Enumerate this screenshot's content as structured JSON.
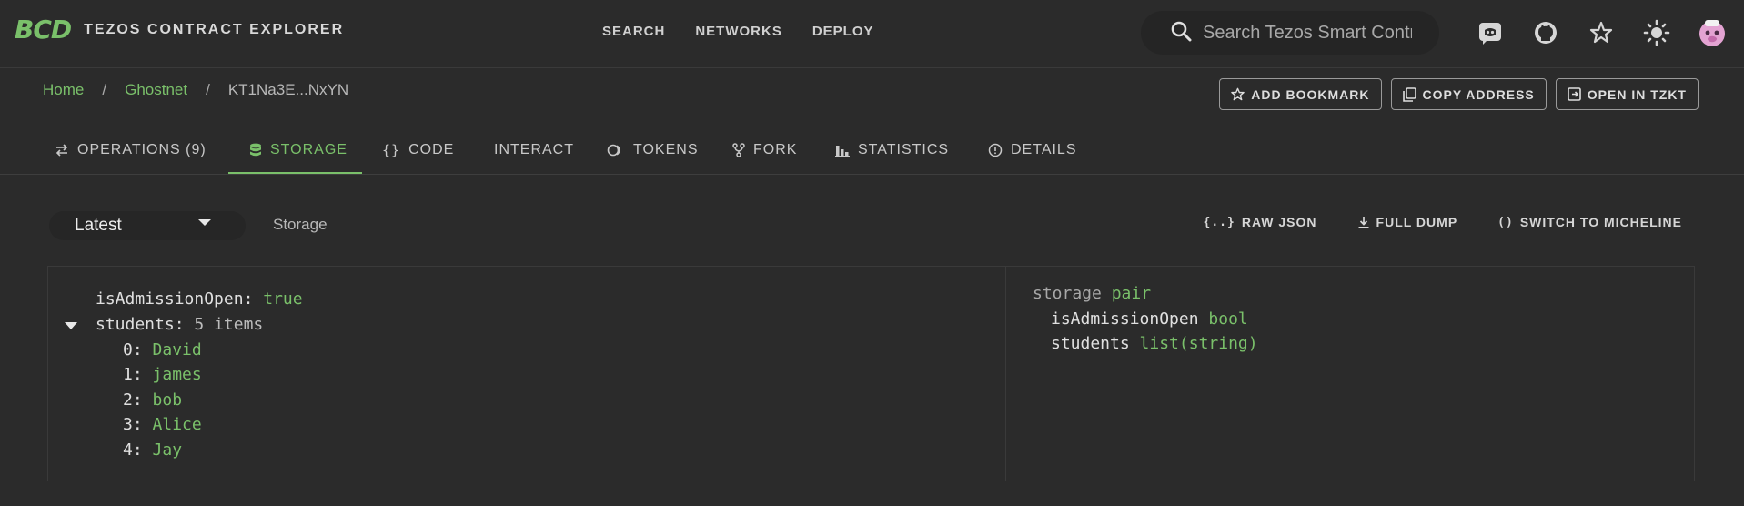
{
  "app": {
    "logo": "BCD",
    "title": "TEZOS CONTRACT EXPLORER"
  },
  "topnav": {
    "search": "SEARCH",
    "networks": "NETWORKS",
    "deploy": "DEPLOY"
  },
  "search": {
    "placeholder": "Search Tezos Smart Contracts"
  },
  "top_icons": [
    "discord-icon",
    "github-icon",
    "star-icon",
    "theme-sun-icon",
    "user-avatar"
  ],
  "breadcrumb": {
    "home": "Home",
    "network": "Ghostnet",
    "contract": "KT1Na3E...NxYN",
    "separator": "/"
  },
  "actions": {
    "bookmark": "ADD BOOKMARK",
    "copy": "COPY ADDRESS",
    "tzkt": "OPEN IN TZKT"
  },
  "tabs": {
    "operations": "OPERATIONS (9)",
    "storage": "STORAGE",
    "code": "CODE",
    "interact": "INTERACT",
    "tokens": "TOKENS",
    "fork": "FORK",
    "statistics": "STATISTICS",
    "details": "DETAILS"
  },
  "storage_toolbar": {
    "version": "Latest",
    "label": "Storage",
    "raw_json": "RAW JSON",
    "full_dump": "FULL DUMP",
    "switch": "SWITCH TO MICHELINE"
  },
  "storage": {
    "is_admission_open_key": "isAdmissionOpen",
    "is_admission_open_value": "true",
    "students_key": "students",
    "students_count": "5 items",
    "students": [
      {
        "index": "0",
        "value": "David"
      },
      {
        "index": "1",
        "value": "james"
      },
      {
        "index": "2",
        "value": "bob"
      },
      {
        "index": "3",
        "value": "Alice"
      },
      {
        "index": "4",
        "value": "Jay"
      }
    ]
  },
  "type_view": {
    "root_name": "storage",
    "root_type": "pair",
    "fields": [
      {
        "name": "isAdmissionOpen",
        "type": "bool"
      },
      {
        "name": "students",
        "type": "list(string)"
      }
    ]
  },
  "colors": {
    "accent": "#7ac06a",
    "background": "#2b2b2b"
  }
}
